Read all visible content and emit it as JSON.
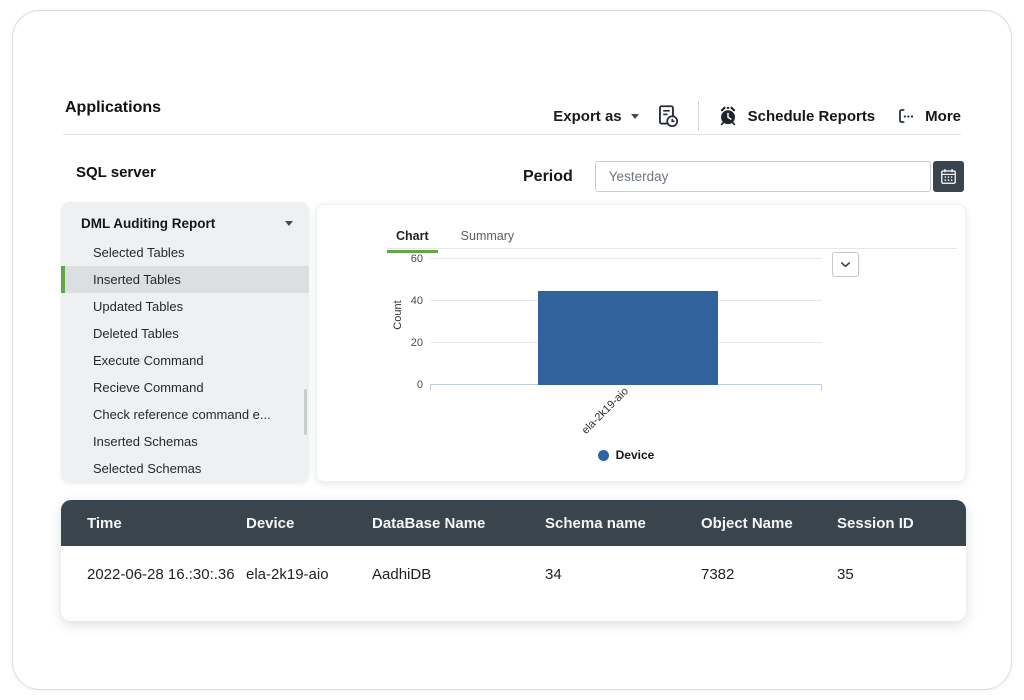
{
  "header": {
    "title": "Applications"
  },
  "toolbar": {
    "export_as": "Export as",
    "schedule_reports": "Schedule Reports",
    "more": "More"
  },
  "filters": {
    "app_name": "SQL server",
    "period_label": "Period",
    "period_value": "Yesterday"
  },
  "sidebar": {
    "group_label": "DML Auditing Report",
    "items": [
      {
        "label": "Selected Tables",
        "selected": false
      },
      {
        "label": "Inserted Tables",
        "selected": true
      },
      {
        "label": "Updated Tables",
        "selected": false
      },
      {
        "label": "Deleted Tables",
        "selected": false
      },
      {
        "label": "Execute Command",
        "selected": false
      },
      {
        "label": "Recieve Command",
        "selected": false
      },
      {
        "label": "Check reference command e...",
        "selected": false
      },
      {
        "label": "Inserted Schemas",
        "selected": false
      },
      {
        "label": "Selected Schemas",
        "selected": false
      }
    ]
  },
  "chart_panel": {
    "tabs": [
      {
        "label": "Chart",
        "active": true
      },
      {
        "label": "Summary",
        "active": false
      }
    ]
  },
  "chart_data": {
    "type": "bar",
    "categories": [
      "ela-2k19-aio"
    ],
    "values": [
      45
    ],
    "title": "",
    "xlabel": "Device",
    "ylabel": "Count",
    "ylim": [
      0,
      60
    ],
    "yticks": [
      0,
      20,
      40,
      60
    ],
    "grid": true,
    "legend_position": "bottom",
    "legend": [
      {
        "label": "Device",
        "color": "#2d62a3"
      }
    ],
    "bar_color": "#30639c"
  },
  "table": {
    "columns": [
      "Time",
      "Device",
      "DataBase Name",
      "Schema name",
      "Object Name",
      "Session ID"
    ],
    "rows": [
      {
        "time": "2022-06-28 16.:30:.36",
        "device": "ela-2k19-aio",
        "database_name": "AadhiDB",
        "schema_name": "34",
        "object_name": "7382",
        "session_id": "35"
      }
    ]
  },
  "colors": {
    "accent_green": "#61a744",
    "bar_blue": "#30639c",
    "table_header_dark": "#39444d"
  }
}
